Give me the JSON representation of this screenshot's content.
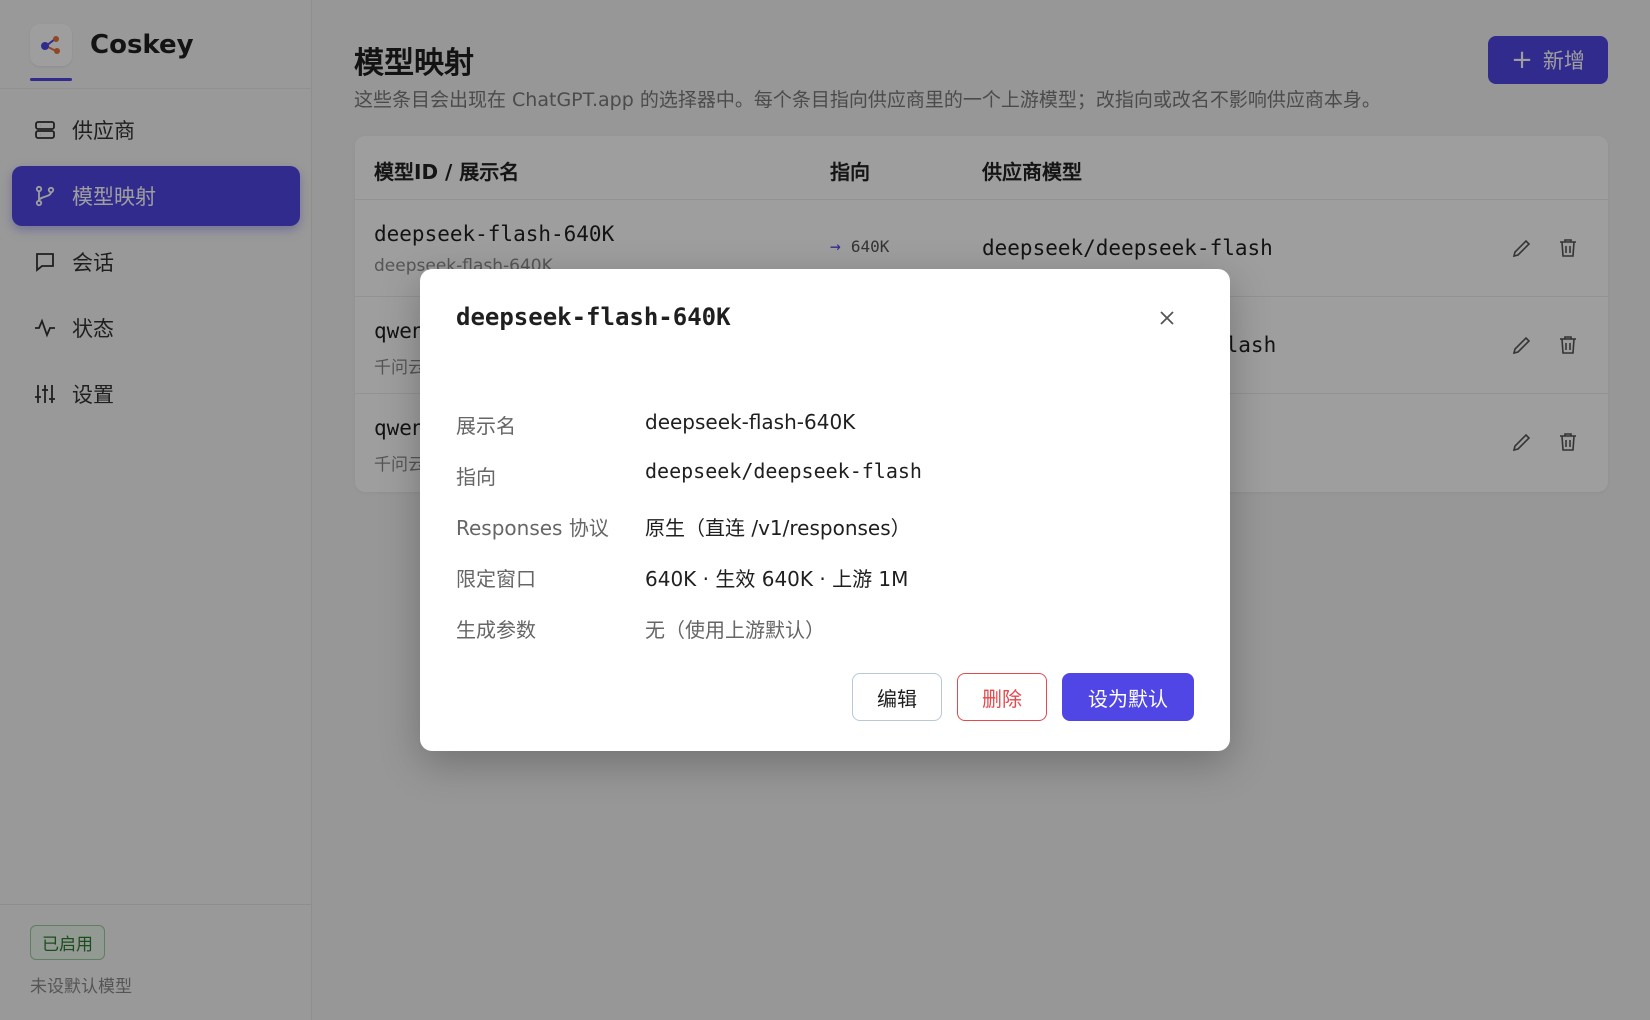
{
  "app": {
    "name": "Coskey",
    "accent": "#4f46e5"
  },
  "sidebar": {
    "items": [
      {
        "label": "供应商",
        "icon": "server-icon"
      },
      {
        "label": "模型映射",
        "icon": "branch-icon",
        "active": true
      },
      {
        "label": "会话",
        "icon": "chat-icon"
      },
      {
        "label": "状态",
        "icon": "activity-icon"
      },
      {
        "label": "设置",
        "icon": "sliders-icon"
      }
    ],
    "status_badge": "已启用",
    "default_note": "未设默认模型"
  },
  "main": {
    "title": "模型映射",
    "description": "这些条目会出现在 ChatGPT.app 的选择器中。每个条目指向供应商里的一个上游模型；改指向或改名不影响供应商本身。",
    "add_label": "新增",
    "table": {
      "headers": [
        "模型ID / 展示名",
        "指向",
        "供应商模型"
      ],
      "rows": [
        {
          "id": "deepseek-flash-640K",
          "display": "deepseek-flash-640K",
          "target": "640K",
          "model": "deepseek/deepseek-flash"
        },
        {
          "id": "qwen",
          "display": "千问云",
          "target": "",
          "model": "flash"
        },
        {
          "id": "qwen",
          "display": "千问云",
          "target": "",
          "model": ""
        }
      ]
    }
  },
  "modal": {
    "title": "deepseek-flash-640K",
    "details": [
      {
        "label": "展示名",
        "value": "deepseek-flash-640K"
      },
      {
        "label": "指向",
        "value": "deepseek/deepseek-flash"
      },
      {
        "label": "Responses 协议",
        "value": "原生（直连 /v1/responses）"
      },
      {
        "label": "限定窗口",
        "value": "640K · 生效 640K · 上游 1M"
      },
      {
        "label": "生成参数",
        "value": "无（使用上游默认）"
      }
    ],
    "buttons": {
      "edit": "编辑",
      "delete": "删除",
      "set_default": "设为默认"
    }
  }
}
